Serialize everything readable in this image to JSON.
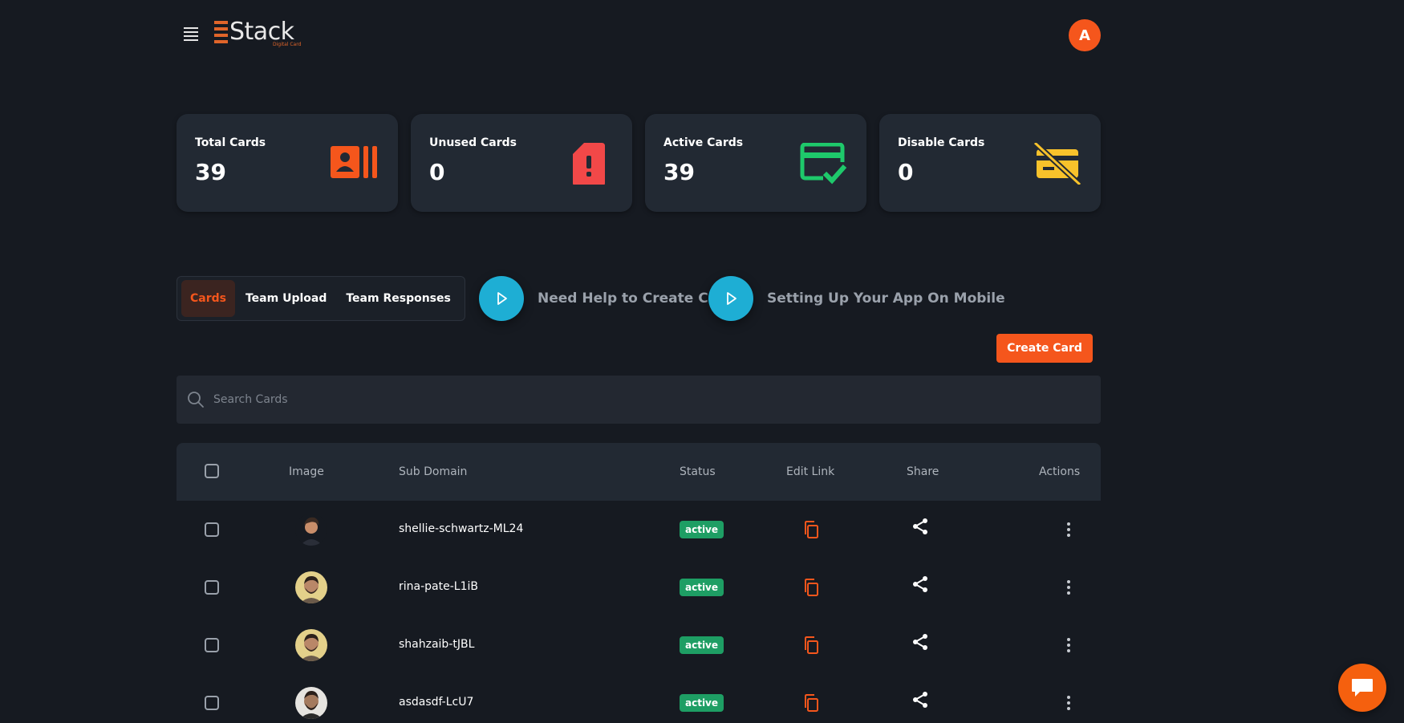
{
  "header": {
    "logo_text": "Stack",
    "logo_sub": "Digital Card",
    "avatar_initial": "A"
  },
  "stats": [
    {
      "label": "Total Cards",
      "value": "39",
      "icon": "contact-card-icon",
      "color": "#f5561c"
    },
    {
      "label": "Unused Cards",
      "value": "0",
      "icon": "sim-alert-icon",
      "color": "#f24848"
    },
    {
      "label": "Active Cards",
      "value": "39",
      "icon": "card-check-icon",
      "color": "#1ec96b"
    },
    {
      "label": "Disable Cards",
      "value": "0",
      "icon": "card-off-icon",
      "color": "#f8c22b"
    }
  ],
  "tabs": [
    {
      "label": "Cards",
      "active": true
    },
    {
      "label": "Team Upload",
      "active": false
    },
    {
      "label": "Team Responses",
      "active": false
    }
  ],
  "help_links": [
    {
      "label": "Need Help to Create Card",
      "icon": "play-icon"
    },
    {
      "label": "Setting Up Your App On Mobile",
      "icon": "play-icon"
    }
  ],
  "create_button": "Create Card",
  "search": {
    "placeholder": "Search Cards"
  },
  "table": {
    "columns": [
      "Image",
      "Sub Domain",
      "Status",
      "Edit Link",
      "Share",
      "Actions"
    ],
    "rows": [
      {
        "sub_domain": "shellie-schwartz-ML24",
        "status": "active"
      },
      {
        "sub_domain": "rina-pate-L1iB",
        "status": "active"
      },
      {
        "sub_domain": "shahzaib-tJBL",
        "status": "active"
      },
      {
        "sub_domain": "asdasdf-LcU7",
        "status": "active"
      }
    ]
  },
  "colors": {
    "accent": "#f5561c",
    "background": "#161a21",
    "card": "#222933",
    "status_active": "#1e9e64",
    "play": "#1eaed4"
  }
}
